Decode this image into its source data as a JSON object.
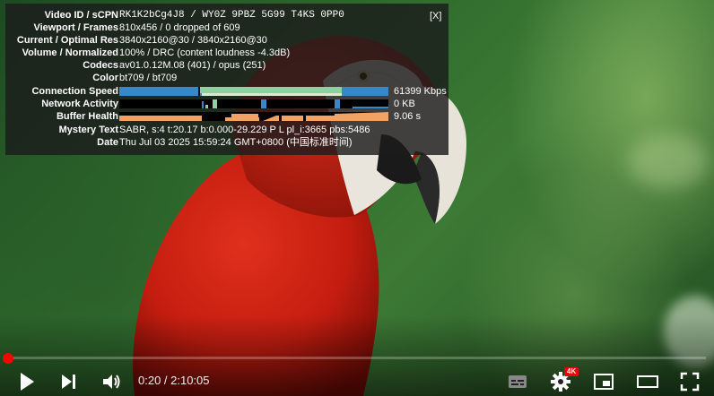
{
  "stats": {
    "close_label": "[X]",
    "rows": [
      {
        "label": "Video ID / sCPN",
        "value": "RK1K2bCg4J8  /  WY0Z 9PBZ 5G99 T4KS 0PP0"
      },
      {
        "label": "Viewport / Frames",
        "value": "810x456 / 0 dropped of 609"
      },
      {
        "label": "Current / Optimal Res",
        "value": "3840x2160@30 / 3840x2160@30"
      },
      {
        "label": "Volume / Normalized",
        "value": "100% / DRC (content loudness -4.3dB)"
      },
      {
        "label": "Codecs",
        "value": "av01.0.12M.08 (401) / opus (251)"
      },
      {
        "label": "Color",
        "value": "bt709 / bt709"
      },
      {
        "label": "Connection Speed",
        "value": "61399 Kbps"
      },
      {
        "label": "Network Activity",
        "value": "0 KB"
      },
      {
        "label": "Buffer Health",
        "value": "9.06 s"
      },
      {
        "label": "Mystery Text",
        "value": "SABR, s:4 t:20.17 b:0.000-29.229 P L pl_i:3665 pbs:5486"
      },
      {
        "label": "Date",
        "value": "Thu Jul 03 2025 15:59:24 GMT+0800 (中国标准时间)"
      }
    ]
  },
  "player": {
    "current_time": "0:20",
    "separator": " / ",
    "duration": "2:10:05",
    "time_display": "0:20 / 2:10:05",
    "played_fraction": 0.0026,
    "quality_badge": "4K"
  },
  "icons": [
    "play-icon",
    "next-icon",
    "volume-icon",
    "subtitles-icon",
    "settings-icon",
    "miniplayer-icon",
    "theater-icon",
    "fullscreen-icon"
  ],
  "colors": {
    "progress_played": "#ff0000",
    "connection_bar": "#3a87c8",
    "connection_fill": "#8fd0a0",
    "buffer_bar": "#f4a261",
    "badge": "#e00000"
  }
}
